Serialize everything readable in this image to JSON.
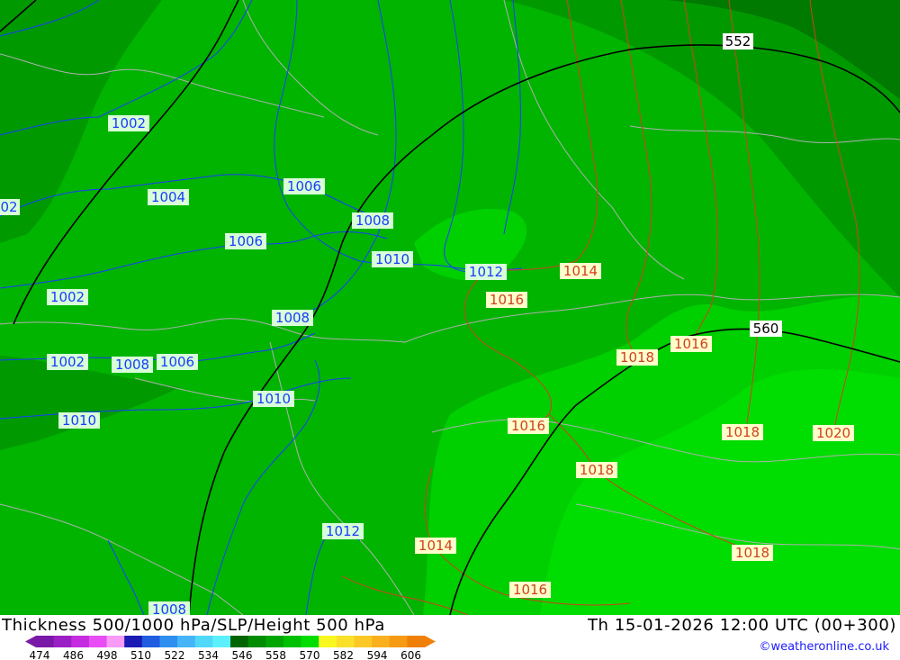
{
  "footer": {
    "title": "Thickness 500/1000 hPa/SLP/Height 500 hPa",
    "datetime": "Th 15-01-2026 12:00 UTC (00+300)",
    "credit": "©weatheronline.co.uk"
  },
  "legend": {
    "ticks": [
      "474",
      "486",
      "498",
      "510",
      "522",
      "534",
      "546",
      "558",
      "570",
      "582",
      "594",
      "606"
    ],
    "colors": [
      "#7a18a8",
      "#9a1fc4",
      "#c52be0",
      "#e94ef4",
      "#f79bf7",
      "#1a1ab4",
      "#1f5ce0",
      "#2f8ff0",
      "#45b5f7",
      "#4fd8f8",
      "#5cf0ff",
      "#006400",
      "#008c00",
      "#00a500",
      "#00c000",
      "#00dd00",
      "#f8f820",
      "#fbe02a",
      "#fcc826",
      "#f9b01e",
      "#f59a12",
      "#f07f08"
    ]
  },
  "map": {
    "colors": {
      "dark_green": "#006e00",
      "mid_green": "#009a00",
      "green": "#00b400",
      "light_green": "#00cf00",
      "bright_green": "#00e000",
      "slp_blue": "#1a3cff",
      "slp_red": "#d04020",
      "height_black": "#000000",
      "border_gray": "#b0b0b0"
    },
    "height_labels": [
      "552",
      "560"
    ],
    "slp_labels_blue": [
      "1002",
      "02",
      "1004",
      "1006",
      "1006",
      "1008",
      "1002",
      "1010",
      "1008",
      "1002",
      "1008",
      "1006",
      "1010",
      "1010",
      "1012",
      "1012",
      "1008"
    ],
    "slp_labels_red": [
      "1014",
      "1016",
      "1016",
      "1018",
      "1016",
      "1018",
      "1020",
      "1018",
      "1014",
      "1018",
      "1016"
    ]
  }
}
